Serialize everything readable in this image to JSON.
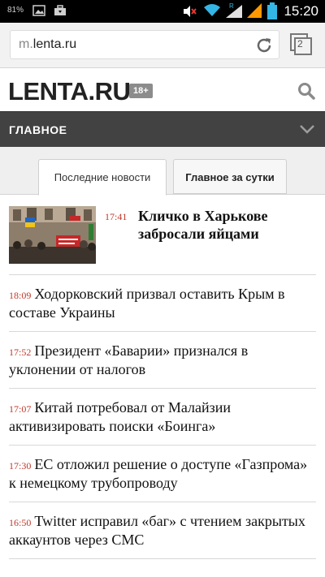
{
  "statusbar": {
    "battery_pct": "81%",
    "time": "15:20",
    "icons": [
      "image-icon",
      "briefcase-icon",
      "mute-icon",
      "wifi-icon",
      "signal-r-icon",
      "signal-icon",
      "battery-icon"
    ]
  },
  "browser": {
    "url_prefix": "m.",
    "url_domain": "lenta.ru",
    "tabs_count": "2"
  },
  "site": {
    "logo": "LENTA.RU",
    "age_badge": "18+"
  },
  "section": {
    "title": "ГЛАВНОЕ"
  },
  "tabs": [
    {
      "label": "Последние новости",
      "active": true
    },
    {
      "label": "Главное за сутки",
      "active": false
    }
  ],
  "lead": {
    "time": "17:41",
    "title": "Кличко в Харькове забросали яйцами"
  },
  "news": [
    {
      "time": "18:09",
      "title": "Ходорковский призвал оставить Крым в составе Украины"
    },
    {
      "time": "17:52",
      "title": "Президент «Баварии» признался в уклонении от налогов"
    },
    {
      "time": "17:07",
      "title": "Китай потребовал от Малайзии активизировать поиски «Боинга»"
    },
    {
      "time": "17:30",
      "title": "ЕС отложил решение о доступе «Газпрома» к немецкому трубопроводу"
    },
    {
      "time": "16:50",
      "title": "Twitter исправил «баг» с чтением закрытых аккаунтов через СМС"
    }
  ],
  "colors": {
    "accent_time": "#c0392b",
    "section_bg": "#424242"
  }
}
